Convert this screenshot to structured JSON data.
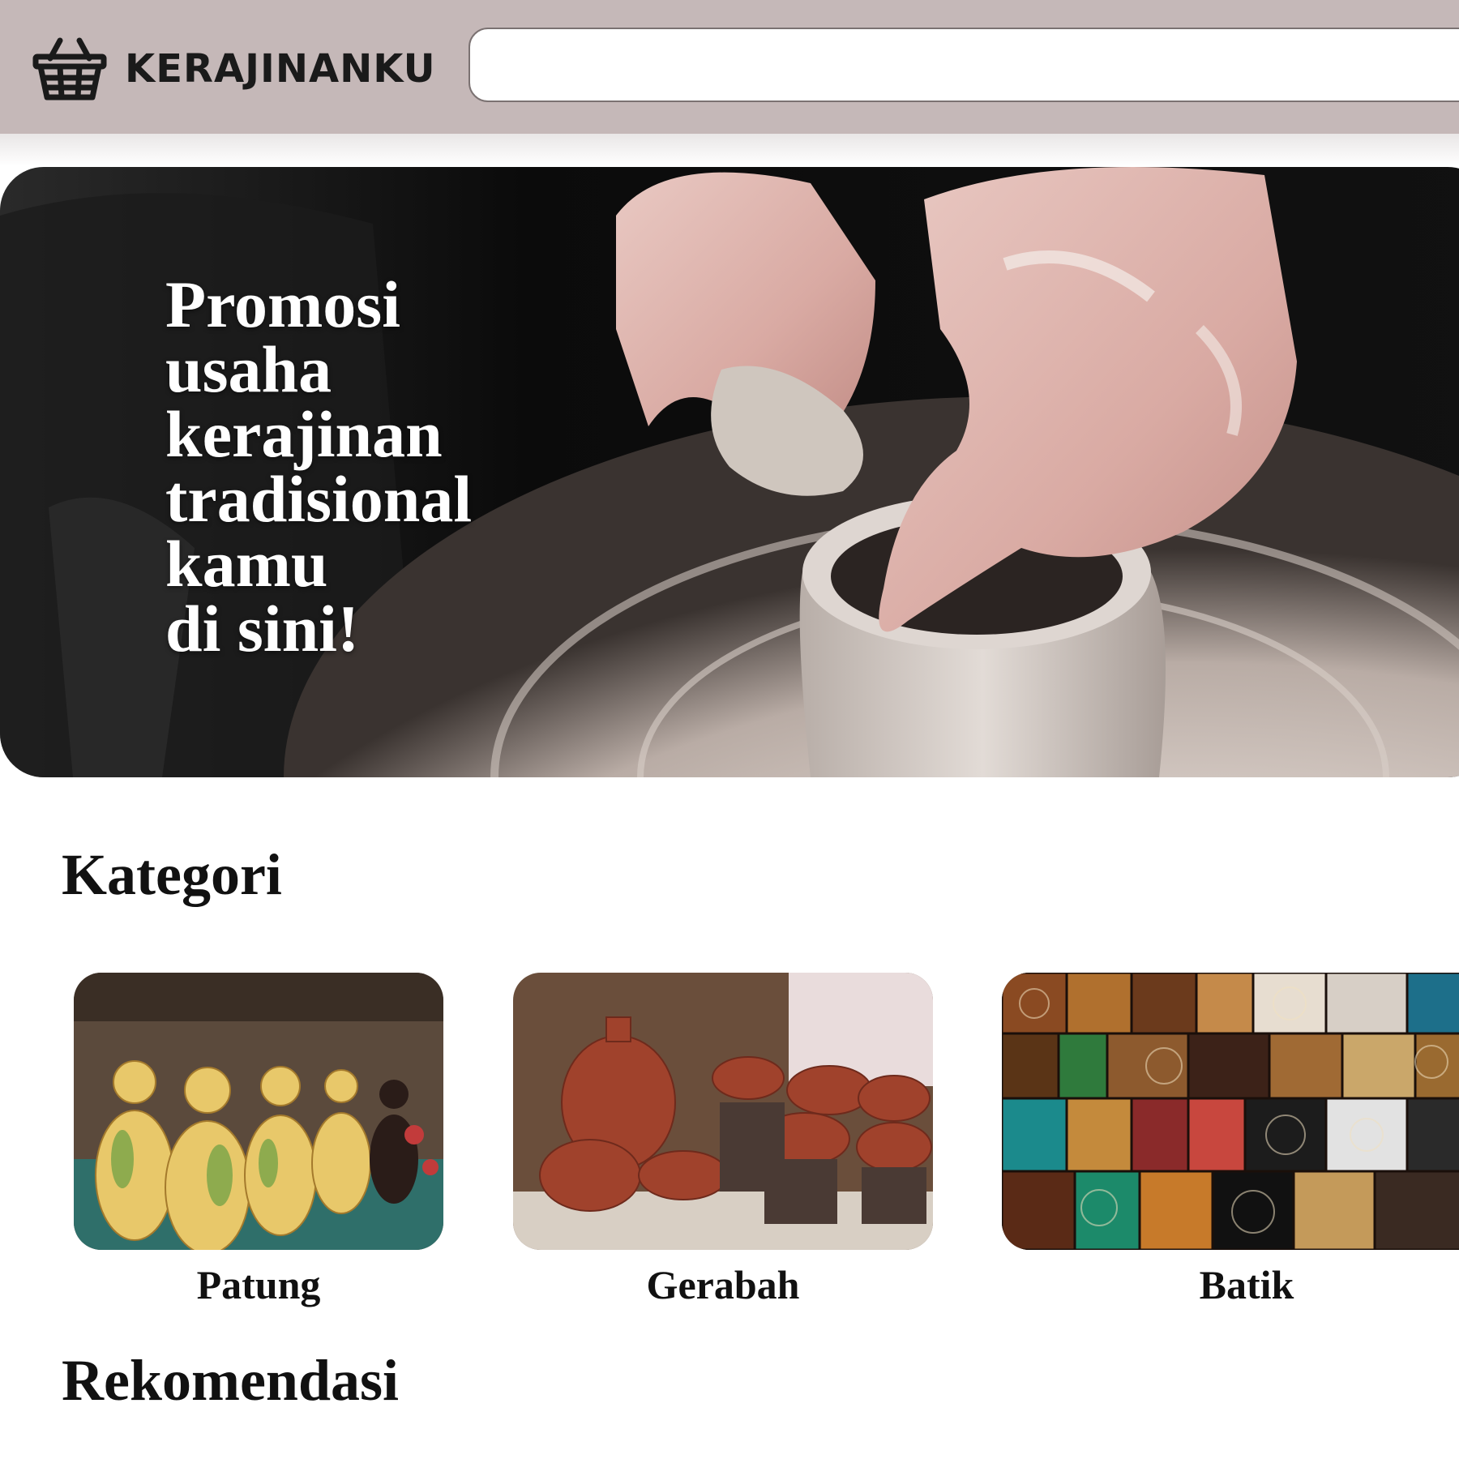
{
  "header": {
    "brand": "KERAJINANKU",
    "logo_icon": "basket-icon",
    "search": {
      "value": "",
      "placeholder": ""
    },
    "colors": {
      "bar": "#c5b8b8",
      "border": "#7b7272"
    }
  },
  "hero": {
    "headline": "Promosi\nusaha\nkerajinan\ntradisional\nkamu\ndi sini!"
  },
  "sections": {
    "kategori": "Kategori",
    "rekomendasi": "Rekomendasi"
  },
  "categories": [
    {
      "label": "Patung"
    },
    {
      "label": "Gerabah"
    },
    {
      "label": "Batik"
    }
  ]
}
